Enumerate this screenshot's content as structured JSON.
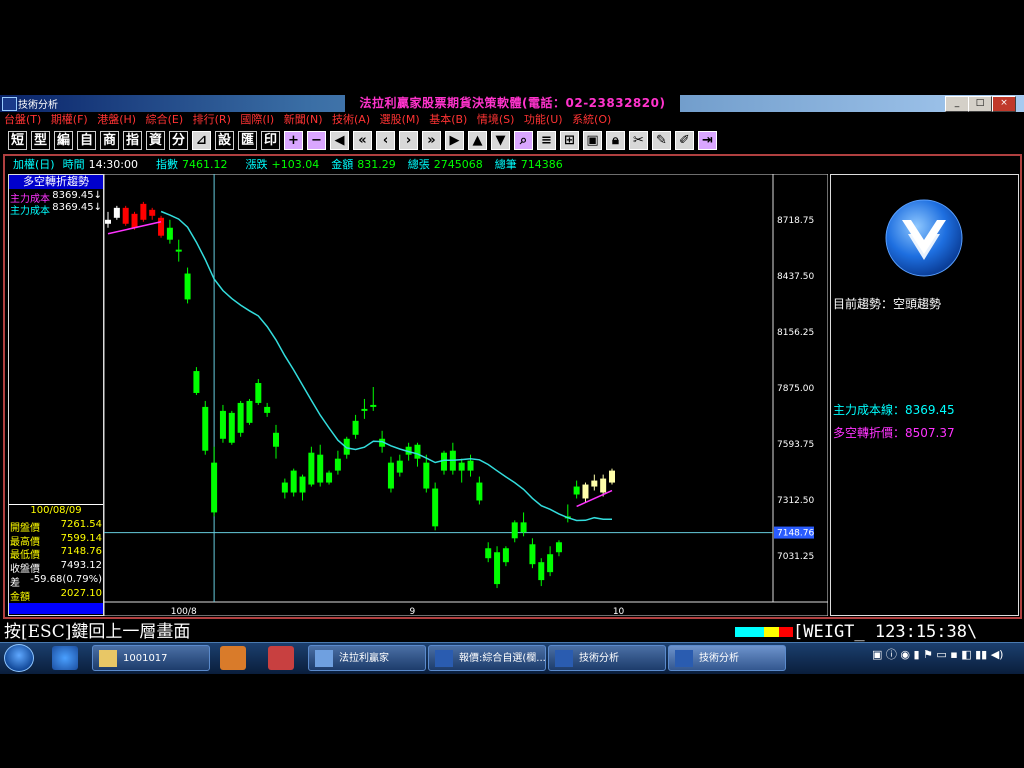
{
  "window": {
    "title": "技術分析",
    "center_title": "法拉利贏家股票期貨決策軟體(電話：02-23832820)",
    "controls": [
      "_",
      "□",
      "×"
    ]
  },
  "menu": [
    "台盤(T)",
    "期權(F)",
    "港盤(H)",
    "綜合(E)",
    "排行(R)",
    "國際(I)",
    "新聞(N)",
    "技術(A)",
    "選股(M)",
    "基本(B)",
    "情境(S)",
    "功能(U)",
    "系統(O)"
  ],
  "toolbar": {
    "text_buttons": [
      "短",
      "型",
      "編",
      "自",
      "商",
      "指",
      "資",
      "分"
    ],
    "text_buttons2": [
      "設",
      "匯",
      "印"
    ]
  },
  "infobar": {
    "name": "加權(日)",
    "time_label": "時間",
    "time_value": "14:30:00",
    "index_label": "指數",
    "index_value": "7461.12",
    "change_label": "漲跌",
    "change_value": "+103.04",
    "amount_label": "金額",
    "amount_value": "831.29",
    "vol_label": "總張",
    "vol_value": "2745068",
    "trades_label": "總筆",
    "trades_value": "714386"
  },
  "left_panel": {
    "title": "多空轉折趨勢",
    "cost_rows": [
      {
        "label": "主力成本",
        "value": "8369.45↓"
      },
      {
        "label": "主力成本",
        "value": "8369.45↓"
      }
    ],
    "date": "100/08/09",
    "quotes": [
      {
        "label": "開盤價",
        "value": "7261.54"
      },
      {
        "label": "最高價",
        "value": "7599.14"
      },
      {
        "label": "最低價",
        "value": "7148.76"
      },
      {
        "label": "收盤價",
        "value": "7493.12"
      },
      {
        "label": "差",
        "value": "-59.68(0.79%)"
      },
      {
        "label": "金額",
        "value": "2027.10"
      }
    ]
  },
  "right_panel": {
    "trend_text": "目前趨勢：空頭趨勢",
    "cost_line": "主力成本線：8369.45",
    "pivot_price": "多空轉折價：8507.37"
  },
  "chart_data": {
    "type": "candlestick",
    "y_ticks": [
      "8718.75",
      "8437.50",
      "8156.25",
      "7875.00",
      "7593.75",
      "7312.50",
      "7031.25"
    ],
    "ylim": [
      6800,
      8950
    ],
    "crosshair_value": "7148.76",
    "x_labels": [
      {
        "label": "100/8",
        "index": 8
      },
      {
        "label": "9",
        "index": 35
      },
      {
        "label": "10",
        "index": 58
      }
    ],
    "colors": {
      "up": "#ff0000",
      "down": "#00ff00",
      "up_recent": "#ffffaa",
      "ma": "#33dddd",
      "cost": "#ff33ff"
    },
    "candles": [
      {
        "o": 8700,
        "h": 8760,
        "l": 8680,
        "c": 8720,
        "t": "w"
      },
      {
        "o": 8730,
        "h": 8790,
        "l": 8720,
        "c": 8780,
        "t": "w"
      },
      {
        "o": 8700,
        "h": 8790,
        "l": 8690,
        "c": 8780,
        "t": "u"
      },
      {
        "o": 8680,
        "h": 8760,
        "l": 8670,
        "c": 8750,
        "t": "u"
      },
      {
        "o": 8720,
        "h": 8810,
        "l": 8710,
        "c": 8800,
        "t": "u"
      },
      {
        "o": 8740,
        "h": 8780,
        "l": 8720,
        "c": 8770,
        "t": "u"
      },
      {
        "o": 8640,
        "h": 8740,
        "l": 8630,
        "c": 8730,
        "t": "u"
      },
      {
        "o": 8680,
        "h": 8720,
        "l": 8600,
        "c": 8620,
        "t": "d"
      },
      {
        "o": 8570,
        "h": 8620,
        "l": 8510,
        "c": 8560,
        "t": "d"
      },
      {
        "o": 8450,
        "h": 8480,
        "l": 8300,
        "c": 8320,
        "t": "d"
      },
      {
        "o": 7960,
        "h": 7980,
        "l": 7840,
        "c": 7850,
        "t": "d"
      },
      {
        "o": 7780,
        "h": 7810,
        "l": 7540,
        "c": 7560,
        "t": "d"
      },
      {
        "o": 7500,
        "h": 7580,
        "l": 7230,
        "c": 7250,
        "t": "d"
      },
      {
        "o": 7760,
        "h": 7790,
        "l": 7600,
        "c": 7620,
        "t": "d"
      },
      {
        "o": 7600,
        "h": 7760,
        "l": 7590,
        "c": 7750,
        "t": "d"
      },
      {
        "o": 7650,
        "h": 7810,
        "l": 7630,
        "c": 7800,
        "t": "d"
      },
      {
        "o": 7700,
        "h": 7820,
        "l": 7690,
        "c": 7810,
        "t": "d"
      },
      {
        "o": 7900,
        "h": 7920,
        "l": 7790,
        "c": 7800,
        "t": "d"
      },
      {
        "o": 7780,
        "h": 7800,
        "l": 7730,
        "c": 7750,
        "t": "d"
      },
      {
        "o": 7650,
        "h": 7690,
        "l": 7520,
        "c": 7580,
        "t": "d"
      },
      {
        "o": 7400,
        "h": 7420,
        "l": 7320,
        "c": 7350,
        "t": "d"
      },
      {
        "o": 7350,
        "h": 7470,
        "l": 7330,
        "c": 7460,
        "t": "d"
      },
      {
        "o": 7350,
        "h": 7440,
        "l": 7310,
        "c": 7430,
        "t": "d"
      },
      {
        "o": 7550,
        "h": 7580,
        "l": 7380,
        "c": 7390,
        "t": "d"
      },
      {
        "o": 7540,
        "h": 7590,
        "l": 7380,
        "c": 7400,
        "t": "d"
      },
      {
        "o": 7400,
        "h": 7460,
        "l": 7390,
        "c": 7450,
        "t": "d"
      },
      {
        "o": 7520,
        "h": 7560,
        "l": 7440,
        "c": 7460,
        "t": "d"
      },
      {
        "o": 7540,
        "h": 7630,
        "l": 7520,
        "c": 7620,
        "t": "d"
      },
      {
        "o": 7640,
        "h": 7740,
        "l": 7620,
        "c": 7710,
        "t": "d"
      },
      {
        "o": 7760,
        "h": 7820,
        "l": 7720,
        "c": 7770,
        "t": "d"
      },
      {
        "o": 7780,
        "h": 7880,
        "l": 7760,
        "c": 7790,
        "t": "d"
      },
      {
        "o": 7620,
        "h": 7660,
        "l": 7550,
        "c": 7580,
        "t": "d"
      },
      {
        "o": 7500,
        "h": 7530,
        "l": 7350,
        "c": 7370,
        "t": "d"
      },
      {
        "o": 7450,
        "h": 7540,
        "l": 7430,
        "c": 7510,
        "t": "d"
      },
      {
        "o": 7540,
        "h": 7600,
        "l": 7510,
        "c": 7580,
        "t": "d"
      },
      {
        "o": 7520,
        "h": 7600,
        "l": 7480,
        "c": 7590,
        "t": "d"
      },
      {
        "o": 7500,
        "h": 7540,
        "l": 7350,
        "c": 7370,
        "t": "d"
      },
      {
        "o": 7370,
        "h": 7400,
        "l": 7160,
        "c": 7180,
        "t": "d"
      },
      {
        "o": 7460,
        "h": 7560,
        "l": 7440,
        "c": 7550,
        "t": "d"
      },
      {
        "o": 7560,
        "h": 7600,
        "l": 7440,
        "c": 7460,
        "t": "d"
      },
      {
        "o": 7460,
        "h": 7520,
        "l": 7400,
        "c": 7500,
        "t": "d"
      },
      {
        "o": 7510,
        "h": 7540,
        "l": 7430,
        "c": 7460,
        "t": "d"
      },
      {
        "o": 7400,
        "h": 7430,
        "l": 7290,
        "c": 7310,
        "t": "d"
      },
      {
        "o": 7070,
        "h": 7100,
        "l": 7000,
        "c": 7020,
        "t": "d"
      },
      {
        "o": 7050,
        "h": 7080,
        "l": 6870,
        "c": 6890,
        "t": "d"
      },
      {
        "o": 7000,
        "h": 7080,
        "l": 6980,
        "c": 7070,
        "t": "d"
      },
      {
        "o": 7120,
        "h": 7210,
        "l": 7100,
        "c": 7200,
        "t": "d"
      },
      {
        "o": 7200,
        "h": 7250,
        "l": 7130,
        "c": 7150,
        "t": "d"
      },
      {
        "o": 7090,
        "h": 7120,
        "l": 6970,
        "c": 6990,
        "t": "d"
      },
      {
        "o": 7000,
        "h": 7020,
        "l": 6880,
        "c": 6910,
        "t": "d"
      },
      {
        "o": 6950,
        "h": 7080,
        "l": 6930,
        "c": 7040,
        "t": "d"
      },
      {
        "o": 7050,
        "h": 7110,
        "l": 7030,
        "c": 7100,
        "t": "d"
      },
      {
        "o": 7220,
        "h": 7290,
        "l": 7200,
        "c": 7230,
        "t": "d"
      },
      {
        "o": 7380,
        "h": 7410,
        "l": 7320,
        "c": 7340,
        "t": "d"
      },
      {
        "o": 7320,
        "h": 7400,
        "l": 7300,
        "c": 7390,
        "t": "y"
      },
      {
        "o": 7380,
        "h": 7440,
        "l": 7360,
        "c": 7410,
        "t": "y"
      },
      {
        "o": 7350,
        "h": 7440,
        "l": 7330,
        "c": 7420,
        "t": "y"
      },
      {
        "o": 7400,
        "h": 7470,
        "l": 7390,
        "c": 7460,
        "t": "y"
      }
    ]
  }
}
